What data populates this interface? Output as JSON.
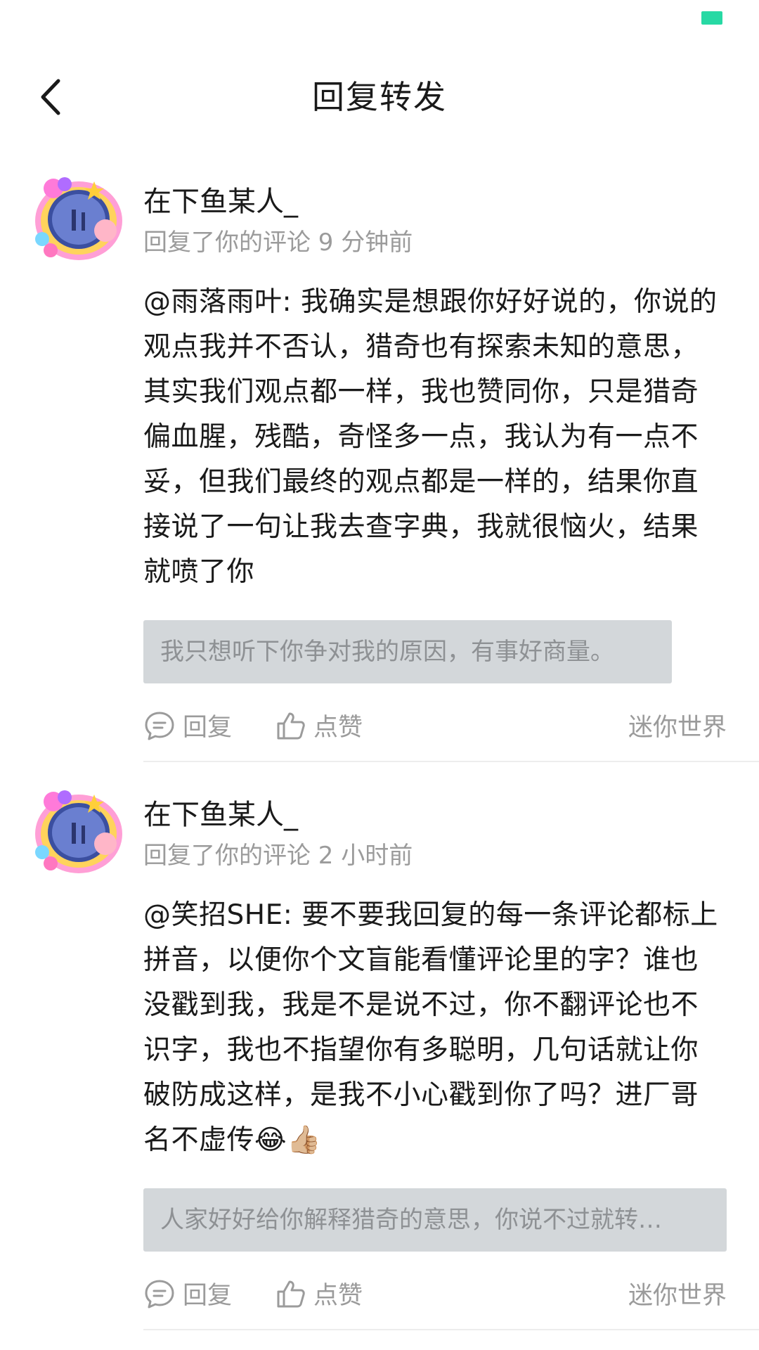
{
  "header": {
    "title": "回复转发"
  },
  "items": [
    {
      "username": "在下鱼某人_",
      "meta": "回复了你的评论 9 分钟前",
      "text": "@雨落雨叶: 我确实是想跟你好好说的，你说的观点我并不否认，猎奇也有探索未知的意思，其实我们观点都一样，我也赞同你，只是猎奇偏血腥，残酷，奇怪多一点，我认为有一点不妥，但我们最终的观点都是一样的，结果你直接说了一句让我去查字典，我就很恼火，结果就喷了你",
      "quote": "我只想听下你争对我的原因，有事好商量。",
      "reply_label": "回复",
      "like_label": "点赞",
      "source": "迷你世界"
    },
    {
      "username": "在下鱼某人_",
      "meta": "回复了你的评论 2 小时前",
      "text": "@笑招SHE: 要不要我回复的每一条评论都标上拼音，以便你个文盲能看懂评论里的字？谁也没戳到我，我是不是说不过，你不翻评论也不识字，我也不指望你有多聪明，几句话就让你破防成这样，是我不小心戳到你了吗？进厂哥名不虚传😂👍🏼",
      "quote": "人家好好给你解释猎奇的意思，你说不过就转…",
      "reply_label": "回复",
      "like_label": "点赞",
      "source": "迷你世界"
    }
  ]
}
